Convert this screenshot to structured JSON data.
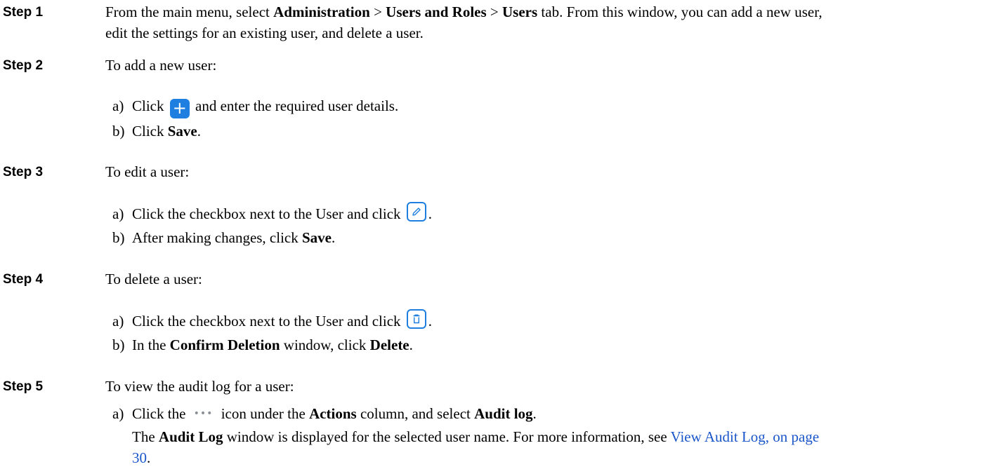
{
  "steps": [
    {
      "label": "Step 1",
      "intro": "From the main menu, select ",
      "menu1": "Administration",
      "sep1": " > ",
      "menu2": "Users and Roles",
      "sep2": " > ",
      "menu3": "Users",
      "rest": " tab. From this window, you can add a new user,",
      "line2": "edit the settings for an existing user, and delete a user."
    },
    {
      "label": "Step 2",
      "text": "To add a new user:",
      "a_mk": "a)",
      "a_pre": "Click ",
      "a_post": " and enter the required user details.",
      "b_mk": "b)",
      "b_pre": "Click ",
      "b_bold": "Save",
      "b_post": "."
    },
    {
      "label": "Step 3",
      "text": "To edit a user:",
      "a_mk": "a)",
      "a_pre": "Click the checkbox next to the User and click ",
      "a_post": ".",
      "b_mk": "b)",
      "b_pre": "After making changes, click ",
      "b_bold": "Save",
      "b_post": "."
    },
    {
      "label": "Step 4",
      "text": "To delete a user:",
      "a_mk": "a)",
      "a_pre": "Click the checkbox next to the User and click ",
      "a_post": ".",
      "b_mk": "b)",
      "b_pre": "In the ",
      "b_bold": "Confirm Deletion",
      "b_mid": " window, click ",
      "b_bold2": "Delete",
      "b_post": "."
    },
    {
      "label": "Step 5",
      "text": "To view the audit log for a user:",
      "a_mk": "a)",
      "a_pre": "Click the ",
      "a_mid": " icon under the ",
      "a_bold": "Actions",
      "a_mid2": " column, and select ",
      "a_bold2": "Audit log",
      "a_post": ".",
      "p_pre": "The ",
      "p_bold": "Audit Log",
      "p_mid": " window is displayed for the selected user name. For more information, see ",
      "p_link1": "View Audit Log, on page",
      "p_link2": "30",
      "p_post": "."
    }
  ],
  "icons": {
    "add": "+",
    "dots": "•••"
  },
  "colors": {
    "accent": "#1f7fe0",
    "link": "#1a56c9"
  }
}
